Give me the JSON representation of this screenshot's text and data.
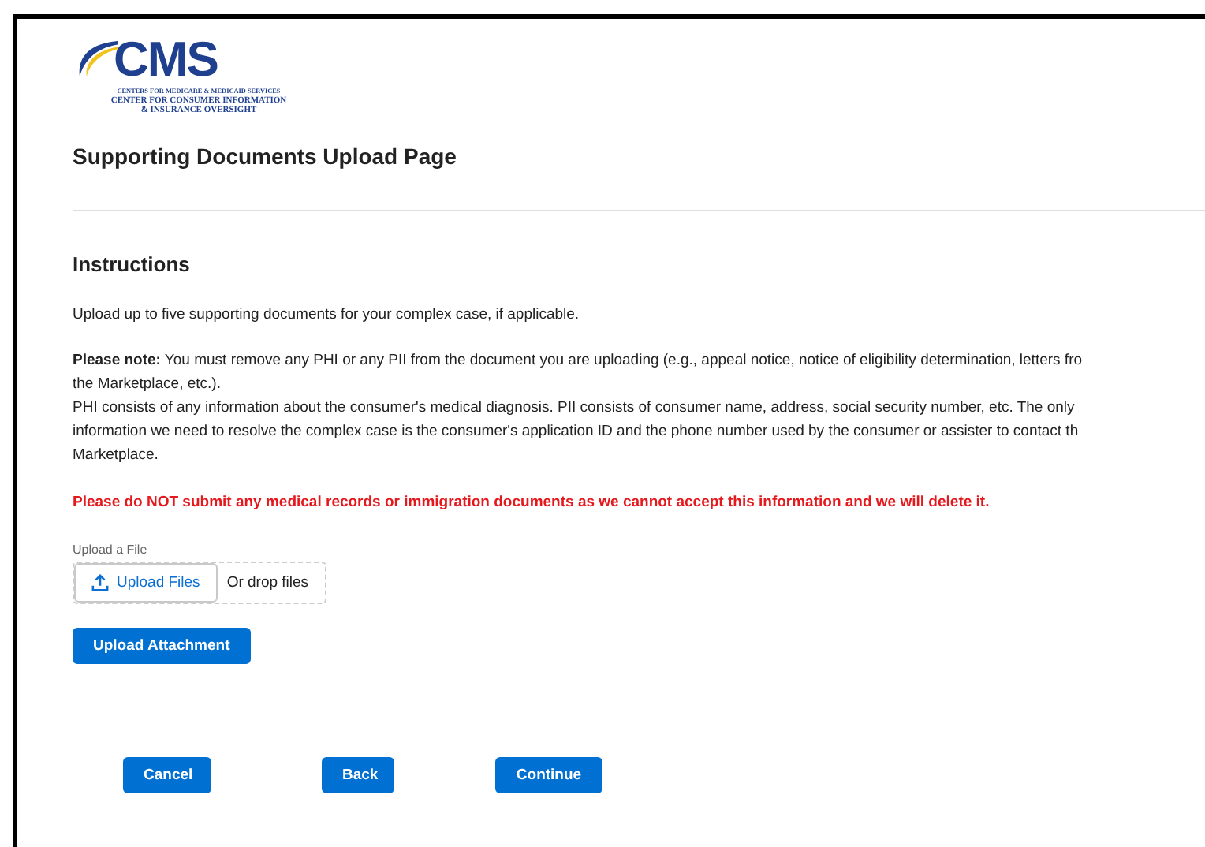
{
  "logo": {
    "wordmark": "CMS",
    "lines": [
      "CENTERS FOR MEDICARE & MEDICAID SERVICES",
      "CENTER FOR CONSUMER INFORMATION",
      "& INSURANCE OVERSIGHT"
    ]
  },
  "page_title": "Supporting Documents Upload Page",
  "instructions": {
    "heading": "Instructions",
    "intro": "Upload up to five supporting documents for your complex case, if applicable.",
    "note_lines": [
      "**Please note:** You must remove any PHI or any PII from the document you are uploading (e.g., appeal notice, notice of eligibility determination, letters fro",
      "the Marketplace, etc.).",
      "PHI consists of any information about the consumer's medical diagnosis. PII consists of consumer name, address, social security number, etc. The only",
      "information we need to resolve the complex case is the consumer's application ID and the phone number used by the consumer or assister to contact th",
      "Marketplace."
    ],
    "warning": "Please do NOT submit any medical records or immigration documents as we cannot accept this information and we will delete it."
  },
  "upload": {
    "label": "Upload a File",
    "button": "Upload Files",
    "drop_text": "Or drop files"
  },
  "attach_button": "Upload Attachment",
  "buttons": [
    "Cancel",
    "Back",
    "Continue"
  ]
}
